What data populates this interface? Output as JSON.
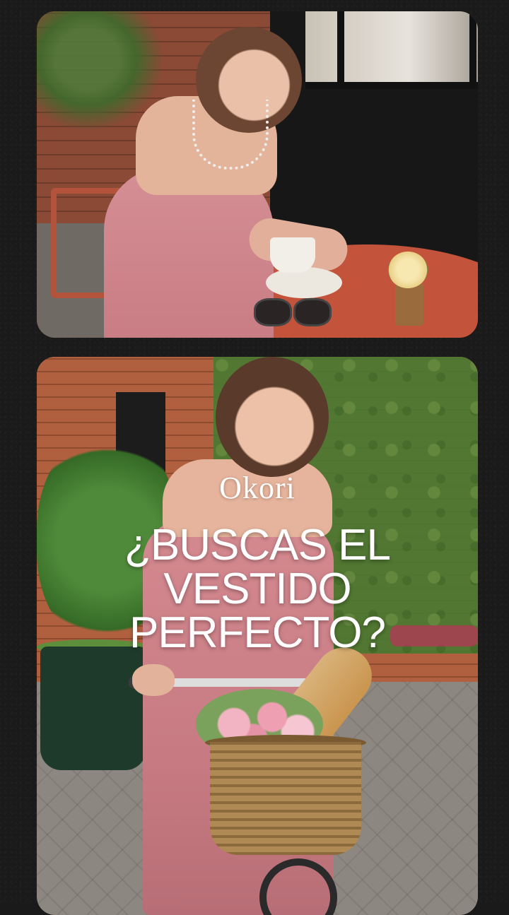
{
  "brand": "Okori",
  "headline": {
    "line1": "¿BUSCAS EL",
    "line2": "VESTIDO",
    "line3": "PERFECTO?"
  }
}
